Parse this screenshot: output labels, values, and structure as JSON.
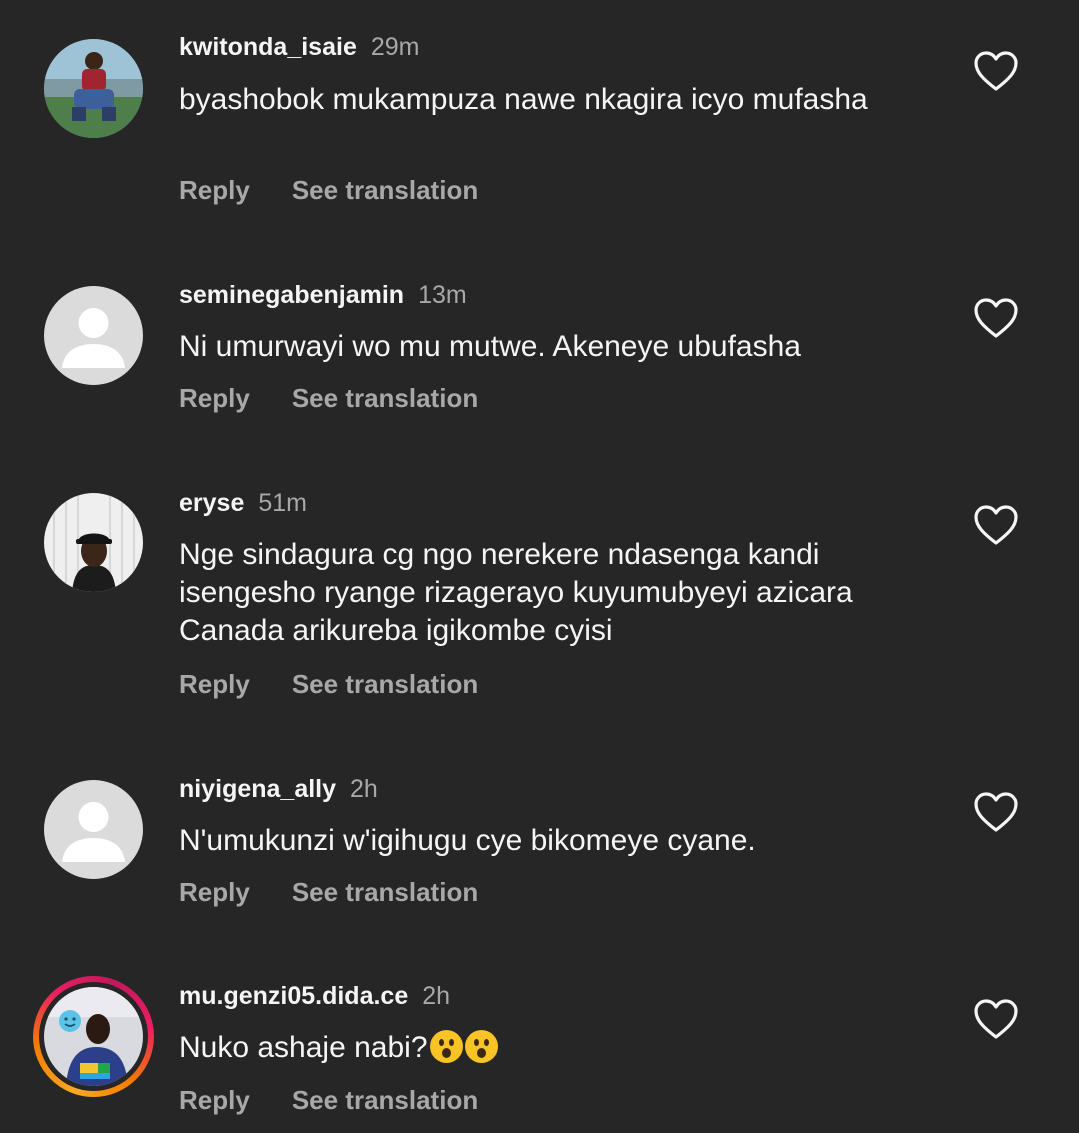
{
  "comments": [
    {
      "username": "kwitonda_isaie",
      "time": "29m",
      "text": "byashobok mukampuza nawe nkagira icyo mufasha",
      "reply_label": "Reply",
      "translate_label": "See translation",
      "avatar": "photo"
    },
    {
      "username": "seminegabenjamin",
      "time": "13m",
      "text": "Ni umurwayi wo mu mutwe. Akeneye ubufasha",
      "reply_label": "Reply",
      "translate_label": "See translation",
      "avatar": "default-avatar-icon"
    },
    {
      "username": "eryse",
      "time": "51m",
      "text": "Nge sindagura cg ngo nerekere ndasenga kandi isengesho ryange rizagerayo kuyumubyeyi azicara Canada arikureba igikombe cyisi",
      "reply_label": "Reply",
      "translate_label": "See translation",
      "avatar": "photo"
    },
    {
      "username": "niyigena_ally",
      "time": "2h",
      "text": "N'umukunzi w'igihugu cye bikomeye cyane.",
      "reply_label": "Reply",
      "translate_label": "See translation",
      "avatar": "default-avatar-icon"
    },
    {
      "username": "mu.genzi05.dida.ce",
      "time": "2h",
      "text": "Nuko ashaje nabi?",
      "emojis": [
        "astonished-face-emoji",
        "astonished-face-emoji"
      ],
      "reply_label": "Reply",
      "translate_label": "See translation",
      "avatar": "photo-with-story-ring"
    }
  ],
  "icons": {
    "like": "heart-outline-icon"
  },
  "colors": {
    "background": "#262626",
    "primary_text": "#f5f5f5",
    "secondary_text": "#a8a8a8",
    "story_ring": [
      "#f9a825",
      "#e91e63"
    ]
  }
}
